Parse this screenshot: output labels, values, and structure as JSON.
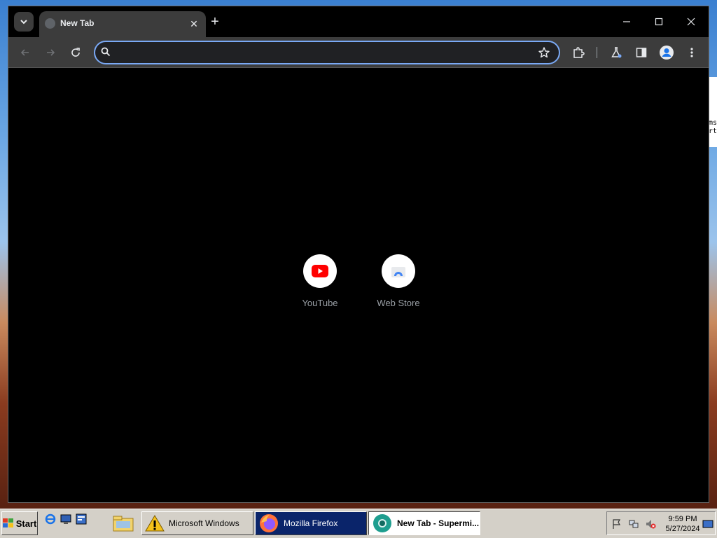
{
  "browser": {
    "tab": {
      "title": "New Tab"
    },
    "omnibox": {
      "value": "",
      "placeholder": ""
    },
    "shortcuts": [
      {
        "label": "YouTube",
        "icon": "youtube-icon"
      },
      {
        "label": "Web Store",
        "icon": "web-store-icon"
      }
    ],
    "colors": {
      "accent": "#7aa9f5",
      "youtube_red": "#ff0000"
    }
  },
  "desktop": {
    "side_text": [
      "ms",
      "rt"
    ]
  },
  "taskbar": {
    "start_label": "Start",
    "tasks": [
      {
        "label": "",
        "icon": "folder-icon"
      },
      {
        "label": "Microsoft Windows",
        "icon": "warning-icon"
      },
      {
        "label": "Mozilla Firefox",
        "icon": "firefox-icon"
      },
      {
        "label": "New Tab - Supermi...",
        "icon": "chrome-icon"
      }
    ],
    "clock": {
      "time": "9:59 PM",
      "date": "5/27/2024"
    }
  }
}
